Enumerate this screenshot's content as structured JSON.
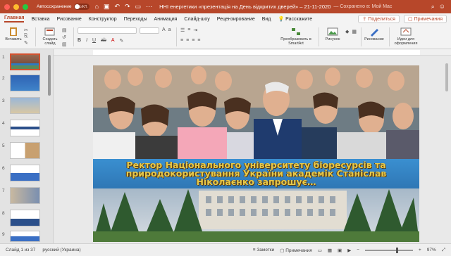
{
  "titlebar": {
    "autosave_label": "Автосохранение",
    "autosave_state": "ВЫКЛ.",
    "document_title": "ННІ енергетики «презентація на День відкритих дверей» – 21-11-2020",
    "saved_status": "— Сохранено в: Мой Mac",
    "colors": {
      "accent": "#b7472a"
    }
  },
  "ribbon_tabs": [
    "Главная",
    "Вставка",
    "Рисование",
    "Конструктор",
    "Переходы",
    "Анимация",
    "Слайд-шоу",
    "Рецензирование",
    "Вид",
    "Расскажите"
  ],
  "active_tab": "Главная",
  "share_label": "Поделиться",
  "comments_label": "Примечания",
  "ribbon": {
    "paste_label": "Вставить",
    "new_slide_label": "Создать слайд",
    "convert_smartart_label": "Преобразовать в SmartArt",
    "picture_label": "Рисунок",
    "drawing_label": "Рисование",
    "design_ideas_label": "Идеи для оформления"
  },
  "thumbnails": [
    {
      "number": "1",
      "selected": true
    },
    {
      "number": "2",
      "selected": false
    },
    {
      "number": "3",
      "selected": false
    },
    {
      "number": "4",
      "selected": false
    },
    {
      "number": "5",
      "selected": false
    },
    {
      "number": "6",
      "selected": false
    },
    {
      "number": "7",
      "selected": false
    },
    {
      "number": "8",
      "selected": false
    },
    {
      "number": "9",
      "selected": false
    }
  ],
  "slide": {
    "caption": "Ректор Національного університету біоресурсів та природокористування України академік Станіслав  Ніколаєнко запрошує…"
  },
  "statusbar": {
    "slide_indicator": "Слайд 1 из 37",
    "language": "русский (Украина)",
    "notes_label": "Заметки",
    "comments_label": "Примечания",
    "zoom": "97%"
  }
}
